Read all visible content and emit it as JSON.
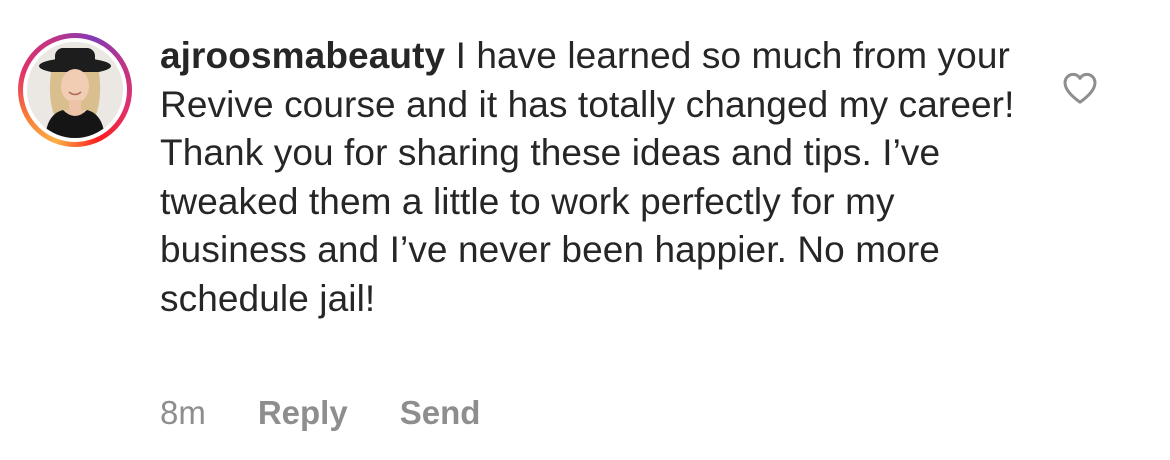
{
  "comment": {
    "username": "ajroosmabeauty",
    "text": "I have learned so much from your Revive course and it has totally changed my career! Thank you for sharing these ideas and tips. I’ve tweaked them a little to work perfectly for my business and I’ve never been happier. No more schedule jail!",
    "time": "8m",
    "reply_label": "Reply",
    "send_label": "Send",
    "like_icon": "heart-outline-icon",
    "avatar_icon": "profile-photo",
    "story_ring_colors": [
      "#fcaf45",
      "#f77737",
      "#e1306c",
      "#c13584",
      "#833ab4"
    ]
  }
}
